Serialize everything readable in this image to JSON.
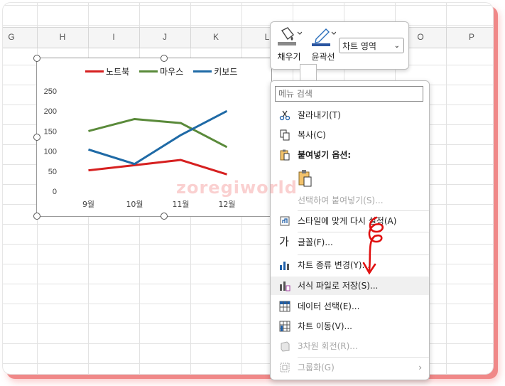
{
  "columns": [
    "G",
    "H",
    "I",
    "J",
    "K",
    "L",
    "O",
    "P"
  ],
  "chart_data": {
    "type": "line",
    "categories": [
      "9월",
      "10월",
      "11월",
      "12월"
    ],
    "series": [
      {
        "name": "노트북",
        "values": [
          52,
          65,
          78,
          42
        ],
        "color": "#d62020"
      },
      {
        "name": "마우스",
        "values": [
          150,
          180,
          170,
          110
        ],
        "color": "#5a8a3a"
      },
      {
        "name": "키보드",
        "values": [
          104,
          68,
          140,
          200
        ],
        "color": "#1f6aa6"
      }
    ],
    "ylim": [
      0,
      250
    ],
    "yticks": [
      "250",
      "200",
      "150",
      "100",
      "50",
      "0"
    ],
    "grid": false,
    "legend": "top"
  },
  "minibar": {
    "fill_label": "채우기",
    "outline_label": "윤곽선",
    "element_select": "차트 영역"
  },
  "menu": {
    "search_placeholder": "메뉴 검색",
    "items": [
      {
        "label": "잘라내기(T)",
        "icon": "scissors-icon"
      },
      {
        "label": "복사(C)",
        "icon": "copy-icon"
      },
      {
        "label": "붙여넣기 옵션:",
        "icon": "paste-icon"
      },
      {
        "label": "선택하여 붙여넣기(S)...",
        "icon": ""
      },
      {
        "label": "스타일에 맞게 다시 설정(A)",
        "icon": "reset-style-icon"
      },
      {
        "label": "글꼴(F)...",
        "icon": "font-icon"
      },
      {
        "label": "차트 종류 변경(Y)...",
        "icon": "chart-type-icon"
      },
      {
        "label": "서식 파일로 저장(S)...",
        "icon": "save-template-icon"
      },
      {
        "label": "데이터 선택(E)...",
        "icon": "select-data-icon"
      },
      {
        "label": "차트 이동(V)...",
        "icon": "move-chart-icon"
      },
      {
        "label": "3차원 회전(R)...",
        "icon": "rotate-3d-icon"
      },
      {
        "label": "그룹화(G)",
        "icon": "group-icon"
      }
    ],
    "font_glyph": "가"
  },
  "watermark": "zoregiworld"
}
